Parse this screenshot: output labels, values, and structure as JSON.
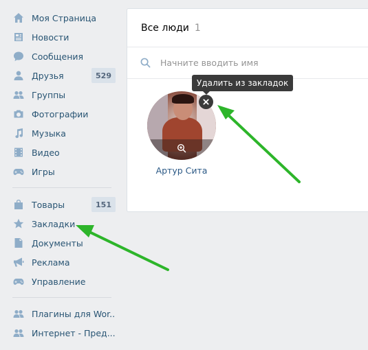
{
  "sidebar": {
    "items": [
      {
        "label": "Моя Страница",
        "icon": "home-icon"
      },
      {
        "label": "Новости",
        "icon": "news-icon"
      },
      {
        "label": "Сообщения",
        "icon": "messages-icon"
      },
      {
        "label": "Друзья",
        "icon": "friends-icon",
        "count": "529"
      },
      {
        "label": "Группы",
        "icon": "groups-icon"
      },
      {
        "label": "Фотографии",
        "icon": "camera-icon"
      },
      {
        "label": "Музыка",
        "icon": "music-icon"
      },
      {
        "label": "Видео",
        "icon": "video-icon"
      },
      {
        "label": "Игры",
        "icon": "gamepad-icon"
      },
      {
        "label": "Товары",
        "icon": "shopping-bag-icon",
        "count": "151"
      },
      {
        "label": "Закладки",
        "icon": "star-icon"
      },
      {
        "label": "Документы",
        "icon": "document-icon"
      },
      {
        "label": "Реклама",
        "icon": "megaphone-icon"
      },
      {
        "label": "Управление",
        "icon": "gamepad-icon"
      },
      {
        "label": "Плагины для Wor...",
        "icon": "people-icon"
      },
      {
        "label": "Интернет - Пред...",
        "icon": "people-icon"
      }
    ]
  },
  "main": {
    "title": "Все люди",
    "count": "1",
    "search_placeholder": "Начните вводить имя",
    "person": {
      "name": "Артур Сита"
    },
    "tooltip": "Удалить из закладок"
  },
  "colors": {
    "link": "#285473",
    "icon": "#8fadc8",
    "arrow": "#29b524",
    "tooltip_bg": "#3a3a3a"
  }
}
